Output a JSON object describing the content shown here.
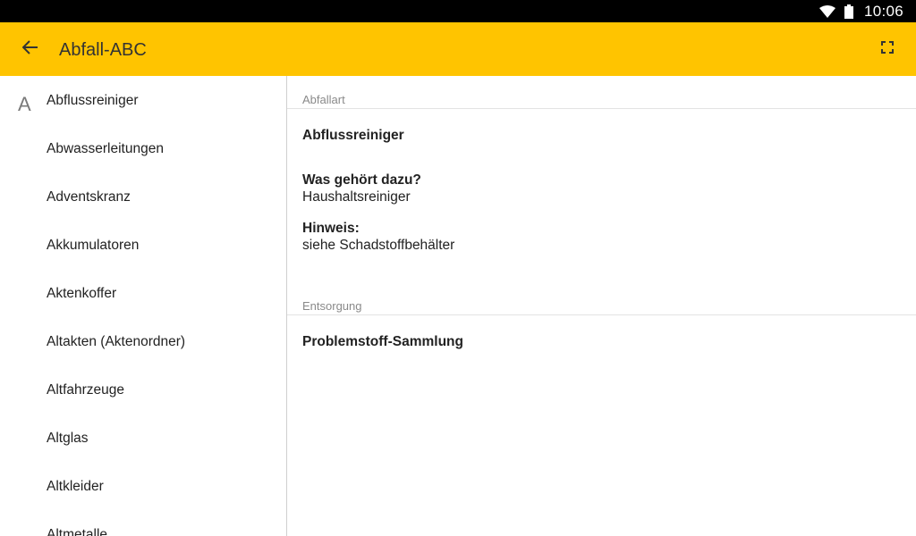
{
  "status": {
    "time": "10:06"
  },
  "appbar": {
    "title": "Abfall-ABC"
  },
  "sidebar": {
    "section_letter": "A",
    "items": [
      {
        "label": "Abflussreiniger"
      },
      {
        "label": "Abwasserleitungen"
      },
      {
        "label": "Adventskranz"
      },
      {
        "label": "Akkumulatoren"
      },
      {
        "label": "Aktenkoffer"
      },
      {
        "label": "Altakten (Aktenordner)"
      },
      {
        "label": "Altfahrzeuge"
      },
      {
        "label": "Altglas"
      },
      {
        "label": "Altkleider"
      },
      {
        "label": "Altmetalle"
      }
    ]
  },
  "detail": {
    "abfallart_header": "Abfallart",
    "item_name": "Abflussreiniger",
    "question_label": "Was gehört dazu?",
    "question_value": "Haushaltsreiniger",
    "hint_label": "Hinweis:",
    "hint_value": "siehe Schadstoffbehälter",
    "entsorgung_header": "Entsorgung",
    "entsorgung_value": "Problemstoff-Sammlung"
  },
  "colors": {
    "appbar": "#FFC400",
    "statusbar": "#000000"
  },
  "icons": [
    "wifi-icon",
    "battery-icon",
    "back-arrow-icon",
    "fullscreen-icon"
  ]
}
